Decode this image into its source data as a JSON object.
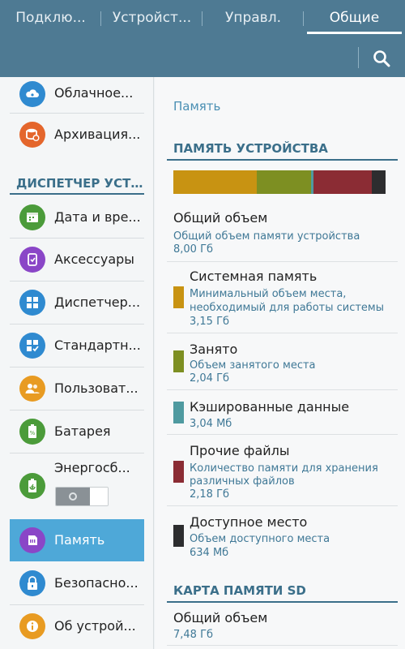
{
  "tabs": [
    {
      "label": "Подклю..."
    },
    {
      "label": "Устройст..."
    },
    {
      "label": "Управл."
    },
    {
      "label": "Общие"
    }
  ],
  "sidebar": {
    "section_title": "ДИСПЕТЧЕР УСТ...",
    "items": [
      {
        "label": "Облачное...",
        "icon": "cloud-icon",
        "color": "#2f8ad0"
      },
      {
        "label": "Архивация...",
        "icon": "backup-icon",
        "color": "#e4662c"
      },
      {
        "label": "Дата и вре...",
        "icon": "calendar-icon",
        "color": "#4b9b3a"
      },
      {
        "label": "Аксессуары",
        "icon": "accessories-icon",
        "color": "#8a46c7"
      },
      {
        "label": "Диспетчер...",
        "icon": "apps-grid-icon",
        "color": "#2f8ad0"
      },
      {
        "label": "Стандартн...",
        "icon": "default-apps-icon",
        "color": "#2f8ad0"
      },
      {
        "label": "Пользоват...",
        "icon": "users-icon",
        "color": "#e89b22"
      },
      {
        "label": "Батарея",
        "icon": "battery-icon",
        "color": "#4b9b3a"
      },
      {
        "label": "Энергосб...",
        "icon": "power-saving-icon",
        "color": "#4b9b3a"
      },
      {
        "label": "Память",
        "icon": "storage-icon",
        "color": "#8a46c7"
      },
      {
        "label": "Безопасно...",
        "icon": "lock-icon",
        "color": "#2f8ad0"
      },
      {
        "label": "Об устрой...",
        "icon": "info-icon",
        "color": "#e89b22"
      }
    ],
    "active_item": "Память",
    "power_saving_toggle": "off"
  },
  "main": {
    "breadcrumb": "Память",
    "device_section": "ПАМЯТЬ УСТРОЙСТВА",
    "usage_bar": [
      {
        "name": "Системная память",
        "fraction": 0.394,
        "color": "#c89312"
      },
      {
        "name": "Занято",
        "fraction": 0.255,
        "color": "#7d8f22"
      },
      {
        "name": "Кэшированные данные",
        "fraction": 0.012,
        "color": "#4f9aa0"
      },
      {
        "name": "Прочие файлы",
        "fraction": 0.273,
        "color": "#8b2c34"
      },
      {
        "name": "Доступное место",
        "fraction": 0.066,
        "color": "#2d2d2f"
      }
    ],
    "total": {
      "title": "Общий объем",
      "subtitle": "Общий объем памяти устройства",
      "value": "8,00 Гб"
    },
    "entries": [
      {
        "title": "Системная память",
        "subtitle_line1": "Минимальный объем места,",
        "subtitle_line2": "необходимый для работы системы",
        "value": "3,15 Гб",
        "color": "#c89312"
      },
      {
        "title": "Занято",
        "subtitle_line1": "Объем занятого места",
        "value": "2,04 Гб",
        "color": "#7d8f22"
      },
      {
        "title": "Кэшированные данные",
        "value": "3,04 Мб",
        "color": "#4f9aa0"
      },
      {
        "title": "Прочие файлы",
        "subtitle_line1": "Количество памяти для хранения",
        "subtitle_line2": "различных файлов",
        "value": "2,18 Гб",
        "color": "#8b2c34"
      },
      {
        "title": "Доступное место",
        "subtitle_line1": "Объем доступного места",
        "value": "634 Мб",
        "color": "#2d2d2f"
      }
    ],
    "sd_section": "КАРТА ПАМЯТИ SD",
    "sd_total": {
      "title": "Общий объем",
      "value": "7,48 Гб"
    }
  }
}
